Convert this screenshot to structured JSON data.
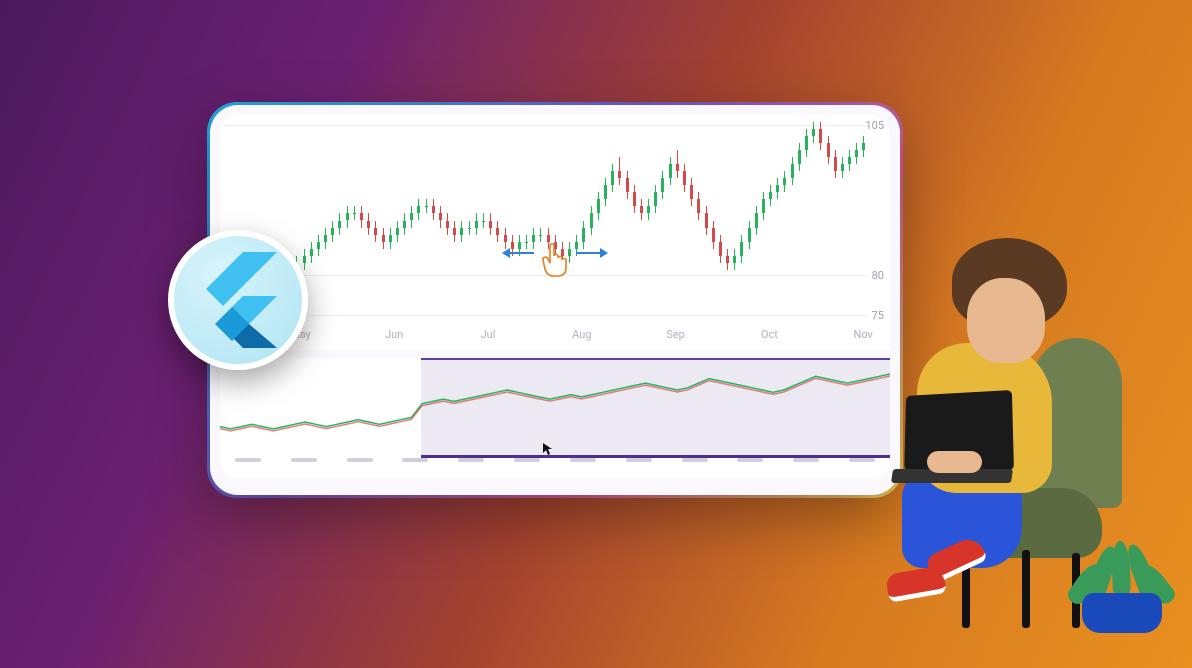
{
  "chart_data": [
    {
      "type": "candlestick",
      "role": "main",
      "xlabel": "",
      "ylabel": "",
      "ylim": [
        75,
        105
      ],
      "y_ticks": [
        75,
        80,
        105
      ],
      "x_categories": [
        "May",
        "Jun",
        "Jul",
        "Aug",
        "Sep",
        "Oct",
        "Nov"
      ],
      "values": [
        {
          "o": 84,
          "h": 85,
          "l": 82,
          "c": 83
        },
        {
          "o": 83,
          "h": 84,
          "l": 81,
          "c": 82
        },
        {
          "o": 82,
          "h": 84,
          "l": 81,
          "c": 83
        },
        {
          "o": 83,
          "h": 85,
          "l": 82,
          "c": 84
        },
        {
          "o": 84,
          "h": 85,
          "l": 83,
          "c": 83
        },
        {
          "o": 83,
          "h": 84,
          "l": 82,
          "c": 82
        },
        {
          "o": 82,
          "h": 83,
          "l": 80,
          "c": 81
        },
        {
          "o": 81,
          "h": 82,
          "l": 80,
          "c": 81
        },
        {
          "o": 81,
          "h": 83,
          "l": 80,
          "c": 82
        },
        {
          "o": 82,
          "h": 84,
          "l": 81,
          "c": 83
        },
        {
          "o": 83,
          "h": 85,
          "l": 82,
          "c": 84
        },
        {
          "o": 84,
          "h": 86,
          "l": 83,
          "c": 85
        },
        {
          "o": 85,
          "h": 87,
          "l": 84,
          "c": 86
        },
        {
          "o": 86,
          "h": 88,
          "l": 85,
          "c": 87
        },
        {
          "o": 87,
          "h": 89,
          "l": 86,
          "c": 88
        },
        {
          "o": 88,
          "h": 90,
          "l": 87,
          "c": 89
        },
        {
          "o": 89,
          "h": 91,
          "l": 88,
          "c": 90
        },
        {
          "o": 90,
          "h": 92,
          "l": 89,
          "c": 91
        },
        {
          "o": 91,
          "h": 92,
          "l": 90,
          "c": 91
        },
        {
          "o": 91,
          "h": 92,
          "l": 89,
          "c": 90
        },
        {
          "o": 90,
          "h": 91,
          "l": 88,
          "c": 89
        },
        {
          "o": 89,
          "h": 90,
          "l": 87,
          "c": 88
        },
        {
          "o": 88,
          "h": 89,
          "l": 86,
          "c": 87
        },
        {
          "o": 87,
          "h": 89,
          "l": 86,
          "c": 88
        },
        {
          "o": 88,
          "h": 90,
          "l": 87,
          "c": 89
        },
        {
          "o": 89,
          "h": 91,
          "l": 88,
          "c": 90
        },
        {
          "o": 90,
          "h": 92,
          "l": 89,
          "c": 91
        },
        {
          "o": 91,
          "h": 93,
          "l": 90,
          "c": 92
        },
        {
          "o": 92,
          "h": 93,
          "l": 91,
          "c": 92
        },
        {
          "o": 92,
          "h": 93,
          "l": 90,
          "c": 91
        },
        {
          "o": 91,
          "h": 92,
          "l": 89,
          "c": 90
        },
        {
          "o": 90,
          "h": 91,
          "l": 88,
          "c": 89
        },
        {
          "o": 89,
          "h": 90,
          "l": 87,
          "c": 88
        },
        {
          "o": 88,
          "h": 90,
          "l": 87,
          "c": 89
        },
        {
          "o": 89,
          "h": 90,
          "l": 88,
          "c": 89
        },
        {
          "o": 89,
          "h": 91,
          "l": 88,
          "c": 90
        },
        {
          "o": 90,
          "h": 91,
          "l": 89,
          "c": 90
        },
        {
          "o": 90,
          "h": 91,
          "l": 88,
          "c": 89
        },
        {
          "o": 89,
          "h": 90,
          "l": 87,
          "c": 88
        },
        {
          "o": 88,
          "h": 89,
          "l": 86,
          "c": 87
        },
        {
          "o": 87,
          "h": 88,
          "l": 85,
          "c": 86
        },
        {
          "o": 86,
          "h": 88,
          "l": 85,
          "c": 87
        },
        {
          "o": 87,
          "h": 88,
          "l": 86,
          "c": 87
        },
        {
          "o": 87,
          "h": 89,
          "l": 86,
          "c": 88
        },
        {
          "o": 88,
          "h": 89,
          "l": 87,
          "c": 88
        },
        {
          "o": 88,
          "h": 89,
          "l": 86,
          "c": 87
        },
        {
          "o": 87,
          "h": 88,
          "l": 85,
          "c": 86
        },
        {
          "o": 86,
          "h": 87,
          "l": 84,
          "c": 85
        },
        {
          "o": 85,
          "h": 87,
          "l": 84,
          "c": 86
        },
        {
          "o": 86,
          "h": 88,
          "l": 85,
          "c": 87
        },
        {
          "o": 87,
          "h": 90,
          "l": 86,
          "c": 89
        },
        {
          "o": 89,
          "h": 92,
          "l": 88,
          "c": 91
        },
        {
          "o": 91,
          "h": 94,
          "l": 90,
          "c": 93
        },
        {
          "o": 93,
          "h": 96,
          "l": 92,
          "c": 95
        },
        {
          "o": 95,
          "h": 98,
          "l": 94,
          "c": 97
        },
        {
          "o": 97,
          "h": 99,
          "l": 95,
          "c": 96
        },
        {
          "o": 96,
          "h": 97,
          "l": 93,
          "c": 94
        },
        {
          "o": 94,
          "h": 95,
          "l": 91,
          "c": 92
        },
        {
          "o": 92,
          "h": 93,
          "l": 90,
          "c": 91
        },
        {
          "o": 91,
          "h": 93,
          "l": 90,
          "c": 92
        },
        {
          "o": 92,
          "h": 95,
          "l": 91,
          "c": 94
        },
        {
          "o": 94,
          "h": 97,
          "l": 93,
          "c": 96
        },
        {
          "o": 96,
          "h": 99,
          "l": 95,
          "c": 98
        },
        {
          "o": 98,
          "h": 100,
          "l": 96,
          "c": 97
        },
        {
          "o": 97,
          "h": 98,
          "l": 94,
          "c": 95
        },
        {
          "o": 95,
          "h": 96,
          "l": 92,
          "c": 93
        },
        {
          "o": 93,
          "h": 94,
          "l": 90,
          "c": 91
        },
        {
          "o": 91,
          "h": 92,
          "l": 88,
          "c": 89
        },
        {
          "o": 89,
          "h": 90,
          "l": 86,
          "c": 87
        },
        {
          "o": 87,
          "h": 88,
          "l": 84,
          "c": 85
        },
        {
          "o": 85,
          "h": 86,
          "l": 83,
          "c": 84
        },
        {
          "o": 84,
          "h": 86,
          "l": 83,
          "c": 85
        },
        {
          "o": 85,
          "h": 88,
          "l": 84,
          "c": 87
        },
        {
          "o": 87,
          "h": 90,
          "l": 86,
          "c": 89
        },
        {
          "o": 89,
          "h": 92,
          "l": 88,
          "c": 91
        },
        {
          "o": 91,
          "h": 94,
          "l": 90,
          "c": 93
        },
        {
          "o": 93,
          "h": 95,
          "l": 92,
          "c": 94
        },
        {
          "o": 94,
          "h": 96,
          "l": 93,
          "c": 95
        },
        {
          "o": 95,
          "h": 97,
          "l": 94,
          "c": 96
        },
        {
          "o": 96,
          "h": 99,
          "l": 95,
          "c": 98
        },
        {
          "o": 98,
          "h": 101,
          "l": 97,
          "c": 100
        },
        {
          "o": 100,
          "h": 103,
          "l": 99,
          "c": 102
        },
        {
          "o": 102,
          "h": 104,
          "l": 101,
          "c": 103
        },
        {
          "o": 103,
          "h": 104,
          "l": 100,
          "c": 101
        },
        {
          "o": 101,
          "h": 102,
          "l": 98,
          "c": 99
        },
        {
          "o": 99,
          "h": 100,
          "l": 96,
          "c": 97
        },
        {
          "o": 97,
          "h": 99,
          "l": 96,
          "c": 98
        },
        {
          "o": 98,
          "h": 100,
          "l": 97,
          "c": 99
        },
        {
          "o": 99,
          "h": 101,
          "l": 98,
          "c": 100
        },
        {
          "o": 100,
          "h": 102,
          "l": 99,
          "c": 101
        }
      ]
    },
    {
      "type": "line",
      "role": "range-navigator",
      "ylim": [
        75,
        110
      ],
      "tick_markers": 12,
      "selected_range": [
        0.3,
        1.0
      ],
      "values": [
        80,
        79,
        80,
        81,
        80,
        79,
        80,
        81,
        82,
        81,
        80,
        81,
        82,
        83,
        82,
        81,
        82,
        83,
        84,
        90,
        91,
        92,
        91,
        92,
        93,
        94,
        95,
        96,
        95,
        94,
        93,
        92,
        93,
        94,
        93,
        94,
        95,
        96,
        97,
        98,
        99,
        98,
        97,
        96,
        97,
        99,
        101,
        100,
        99,
        98,
        97,
        96,
        95,
        96,
        98,
        100,
        102,
        101,
        100,
        99,
        100,
        101,
        102,
        103
      ]
    }
  ],
  "labels": {
    "y_105": "105",
    "y_80": "80",
    "y_75": "75",
    "x": [
      "May",
      "Jun",
      "Jul",
      "Aug",
      "Sep",
      "Oct",
      "Nov"
    ]
  },
  "icons": {
    "logo": "flutter"
  }
}
